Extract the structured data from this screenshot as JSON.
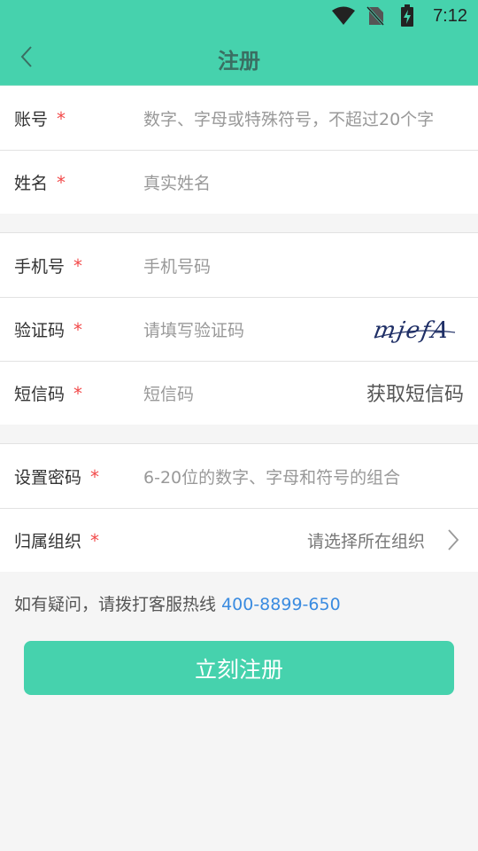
{
  "status_bar": {
    "time": "7:12",
    "icons": [
      "wifi-icon",
      "no-sim-icon",
      "battery-charging-icon"
    ]
  },
  "header": {
    "title": "注册",
    "back_icon": "chevron-left-icon"
  },
  "form": {
    "required_mark": "*",
    "account": {
      "label": "账号",
      "placeholder": "数字、字母或特殊符号，不超过20个字"
    },
    "name": {
      "label": "姓名",
      "placeholder": "真实姓名"
    },
    "phone": {
      "label": "手机号",
      "placeholder": "手机号码"
    },
    "captcha": {
      "label": "验证码",
      "placeholder": "请填写验证码",
      "image_text": "mjefA"
    },
    "sms": {
      "label": "短信码",
      "placeholder": "短信码",
      "button": "获取短信码"
    },
    "password": {
      "label": "设置密码",
      "placeholder": "6-20位的数字、字母和符号的组合"
    },
    "org": {
      "label": "归属组织",
      "placeholder": "请选择所在组织",
      "icon": "chevron-right-icon"
    }
  },
  "hotline": {
    "text": "如有疑问，请拨打客服热线",
    "phone": "400-8899-650"
  },
  "submit_label": "立刻注册",
  "colors": {
    "primary": "#46d2ad",
    "required": "#f24a4a",
    "link": "#3a8be0"
  }
}
